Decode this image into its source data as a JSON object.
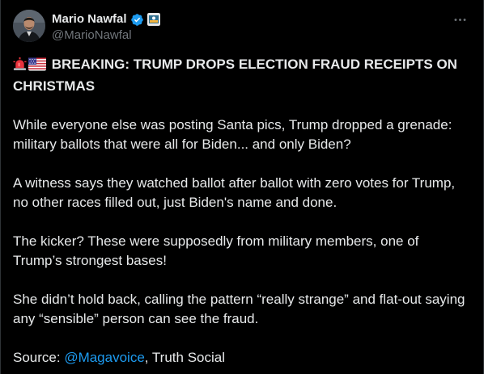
{
  "author": {
    "display_name": "Mario Nawfal",
    "handle": "@MarioNawfal",
    "verified_color": "#1d9bf0",
    "avatar_icon": "profile-photo",
    "badge_icon": "affiliate-badge"
  },
  "menu": {
    "icon": "more-horizontal-icon"
  },
  "post": {
    "headline_emojis": [
      "rotating-light-icon",
      "us-flag-icon"
    ],
    "headline": "BREAKING: TRUMP DROPS ELECTION FRAUD RECEIPTS ON CHRISTMAS",
    "paragraphs": [
      "While everyone else was posting Santa pics, Trump dropped a grenade: military ballots that were all for Biden... and only Biden?",
      "A witness says they watched ballot after ballot with zero votes for Trump, no other races filled out, just Biden's name and done.",
      "The kicker? These were supposedly from military members, one of Trump’s strongest bases!",
      "She didn’t hold back, calling the pattern “really strange” and flat-out saying any “sensible” person can see the fraud."
    ],
    "source_prefix": "Source: ",
    "source_mention": "@Magavoice",
    "source_suffix": ", Truth Social"
  },
  "colors": {
    "background": "#000000",
    "text": "#e7e9ea",
    "secondary": "#71767b",
    "link": "#1d9bf0"
  }
}
